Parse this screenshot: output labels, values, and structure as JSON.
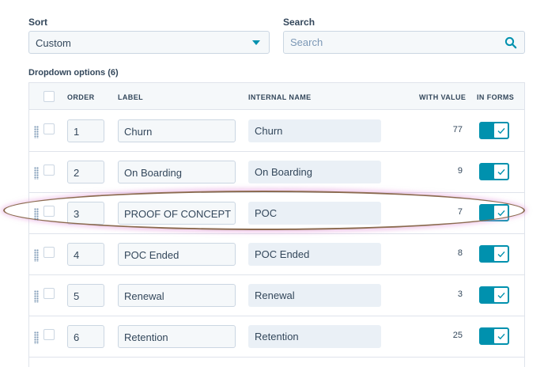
{
  "sort": {
    "label": "Sort",
    "value": "Custom"
  },
  "search": {
    "label": "Search",
    "placeholder": "Search"
  },
  "section": {
    "title": "Dropdown options (6)"
  },
  "table": {
    "headers": {
      "order": "ORDER",
      "label": "LABEL",
      "internal_name": "INTERNAL NAME",
      "with_value": "WITH VALUE",
      "in_forms": "IN FORMS"
    },
    "rows": [
      {
        "order": "1",
        "label": "Churn",
        "internal_name": "Churn",
        "with_value": "77",
        "in_forms": true
      },
      {
        "order": "2",
        "label": "On Boarding",
        "internal_name": "On Boarding",
        "with_value": "9",
        "in_forms": true
      },
      {
        "order": "3",
        "label": "PROOF OF CONCEPT",
        "internal_name": "POC",
        "with_value": "7",
        "in_forms": true
      },
      {
        "order": "4",
        "label": "POC Ended",
        "internal_name": "POC Ended",
        "with_value": "8",
        "in_forms": true
      },
      {
        "order": "5",
        "label": "Renewal",
        "internal_name": "Renewal",
        "with_value": "3",
        "in_forms": true
      },
      {
        "order": "6",
        "label": "Retention",
        "internal_name": "Retention",
        "with_value": "25",
        "in_forms": true
      }
    ]
  },
  "colors": {
    "accent": "#0091ae",
    "highlight_ring": "#8b6a4f",
    "text": "#33475b"
  },
  "icons": {
    "search": "search-icon",
    "caret": "caret-down-icon",
    "drag": "drag-handle-icon",
    "check": "check-icon"
  }
}
